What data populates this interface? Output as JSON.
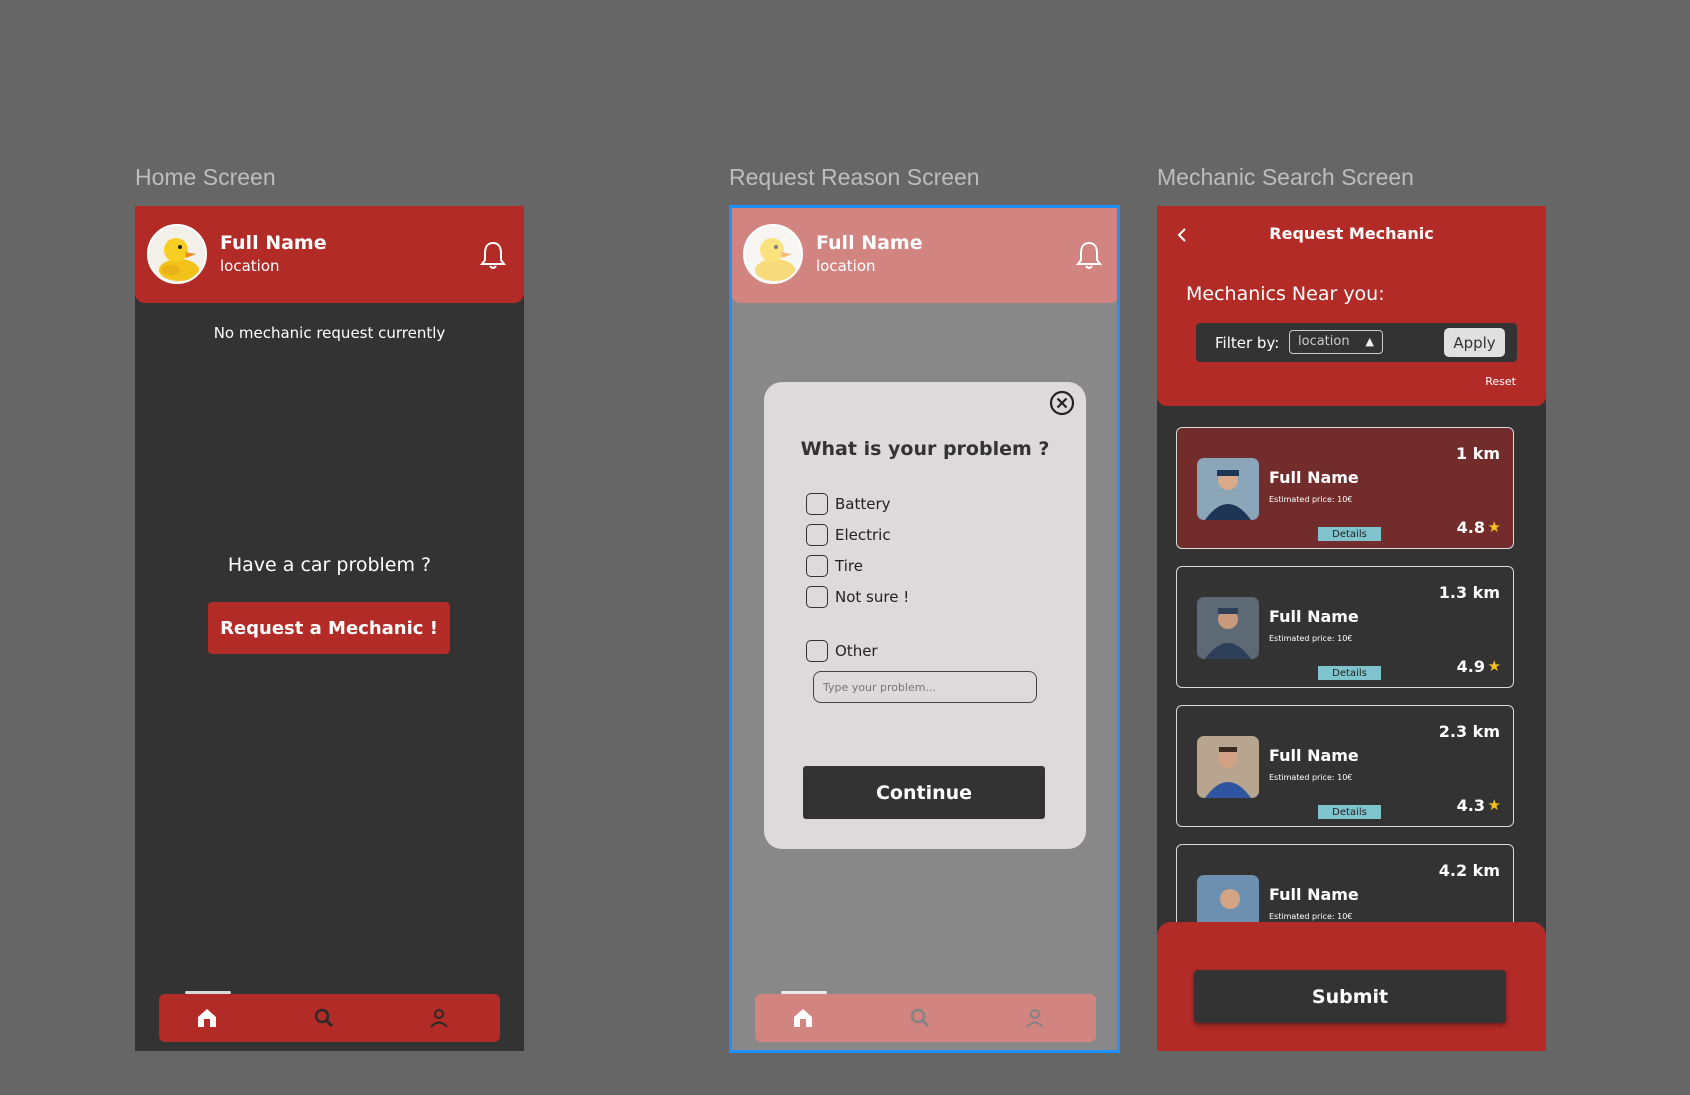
{
  "frames": {
    "home_label": "Home Screen",
    "request_label": "Request Reason Screen",
    "search_label": "Mechanic Search Screen"
  },
  "header": {
    "name": "Full Name",
    "location": "location"
  },
  "home": {
    "status": "No mechanic request currently",
    "prompt": "Have a car problem ?",
    "request_button": "Request a Mechanic !"
  },
  "request_reason": {
    "question": "What is your problem ?",
    "options": [
      "Battery",
      "Electric",
      "Tire",
      "Not sure !",
      "Other"
    ],
    "other_placeholder": "Type your problem...",
    "continue_label": "Continue"
  },
  "search": {
    "title": "Request Mechanic",
    "heading": "Mechanics Near you:",
    "filter_label": "Filter by:",
    "filter_value": "location",
    "apply_label": "Apply",
    "reset_label": "Reset",
    "cards": [
      {
        "name": "Full Name",
        "price": "Estimated price: 10€",
        "distance": "1 km",
        "rating": "4.8",
        "details": "Details",
        "highlighted": true
      },
      {
        "name": "Full Name",
        "price": "Estimated price: 10€",
        "distance": "1.3 km",
        "rating": "4.9",
        "details": "Details",
        "highlighted": false
      },
      {
        "name": "Full Name",
        "price": "Estimated price: 10€",
        "distance": "2.3 km",
        "rating": "4.3",
        "details": "Details",
        "highlighted": false
      },
      {
        "name": "Full Name",
        "price": "Estimated price: 10€",
        "distance": "4.2 km",
        "rating": "",
        "details": "",
        "highlighted": false
      }
    ],
    "submit_label": "Submit"
  },
  "icons": {
    "avatar": "duck-avatar",
    "bell": "bell-icon",
    "nav": [
      "home-icon",
      "search-icon",
      "profile-icon"
    ],
    "close": "close-circle-icon",
    "back": "chevron-left-icon",
    "star": "star-icon"
  },
  "colors": {
    "brand_red": "#b22b27",
    "dark": "#333333",
    "modal": "#dcdadb",
    "highlight_card": "#722c2b",
    "selection": "#1e90ff",
    "star": "#f6c21a"
  }
}
